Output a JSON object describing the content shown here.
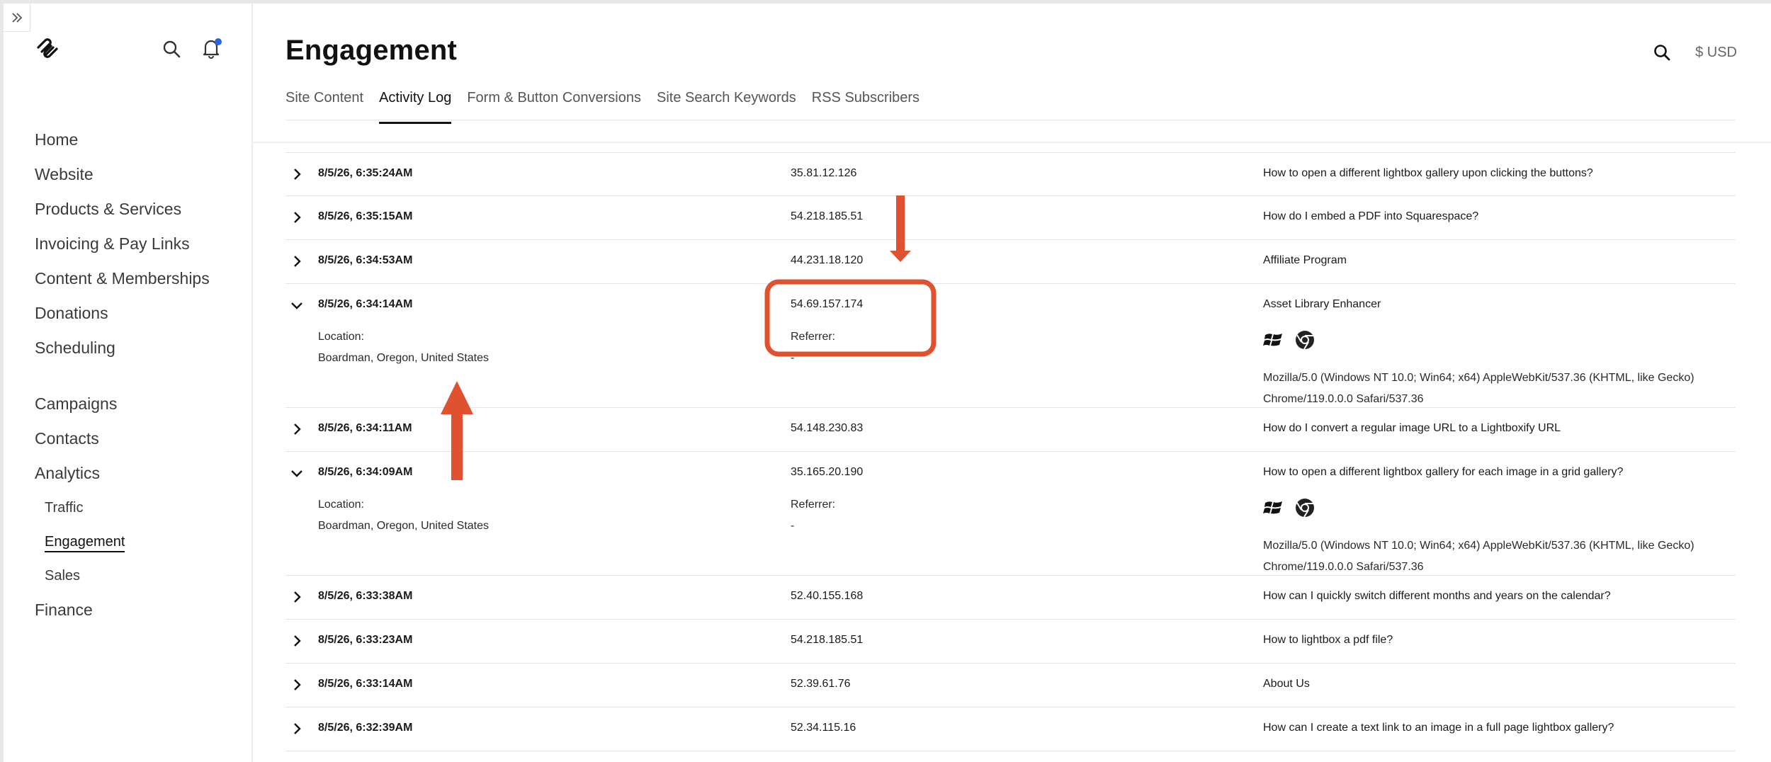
{
  "sidebar": {
    "items": [
      "Home",
      "Website",
      "Products & Services",
      "Invoicing & Pay Links",
      "Content & Memberships",
      "Donations",
      "Scheduling"
    ],
    "items2": [
      "Campaigns",
      "Contacts",
      "Analytics"
    ],
    "analytics_sub": [
      "Traffic",
      "Engagement",
      "Sales"
    ],
    "finance": "Finance"
  },
  "header": {
    "title": "Engagement",
    "currency": "$ USD",
    "tabs": [
      "Site Content",
      "Activity Log",
      "Form & Button Conversions",
      "Site Search Keywords",
      "RSS Subscribers"
    ],
    "active_tab": "Activity Log"
  },
  "log": {
    "location_label": "Location:",
    "referrer_label": "Referrer:",
    "rows": [
      {
        "time": "8/5/26, 6:35:24AM",
        "ip": "35.81.12.126",
        "page": "How to open a different lightbox gallery upon clicking the buttons?",
        "expanded": false
      },
      {
        "time": "8/5/26, 6:35:15AM",
        "ip": "54.218.185.51",
        "page": "How do I embed a PDF into Squarespace?",
        "expanded": false
      },
      {
        "time": "8/5/26, 6:34:53AM",
        "ip": "44.231.18.120",
        "page": "Affiliate Program",
        "expanded": false
      },
      {
        "time": "8/5/26, 6:34:14AM",
        "ip": "54.69.157.174",
        "page": "Asset Library Enhancer",
        "expanded": true,
        "location": "Boardman, Oregon, United States",
        "referrer": "-",
        "user_agent": "Mozilla/5.0 (Windows NT 10.0; Win64; x64) AppleWebKit/537.36 (KHTML, like Gecko) Chrome/119.0.0.0 Safari/537.36"
      },
      {
        "time": "8/5/26, 6:34:11AM",
        "ip": "54.148.230.83",
        "page": "How do I convert a regular image URL to a Lightboxify URL",
        "expanded": false
      },
      {
        "time": "8/5/26, 6:34:09AM",
        "ip": "35.165.20.190",
        "page": "How to open a different lightbox gallery for each image in a grid gallery?",
        "expanded": true,
        "location": "Boardman, Oregon, United States",
        "referrer": "-",
        "user_agent": "Mozilla/5.0 (Windows NT 10.0; Win64; x64) AppleWebKit/537.36 (KHTML, like Gecko) Chrome/119.0.0.0 Safari/537.36"
      },
      {
        "time": "8/5/26, 6:33:38AM",
        "ip": "52.40.155.168",
        "page": "How can I quickly switch different months and years on the calendar?",
        "expanded": false
      },
      {
        "time": "8/5/26, 6:33:23AM",
        "ip": "54.218.185.51",
        "page": "How to lightbox a pdf file?",
        "expanded": false
      },
      {
        "time": "8/5/26, 6:33:14AM",
        "ip": "52.39.61.76",
        "page": "About Us",
        "expanded": false
      },
      {
        "time": "8/5/26, 6:32:39AM",
        "ip": "52.34.115.16",
        "page": "How can I create a text link to an image in a full page lightbox gallery?",
        "expanded": false
      }
    ]
  },
  "colors": {
    "annotation": "#e0522f",
    "notification_dot": "#2a64d6"
  },
  "icons": [
    "sidebar-expand-icon",
    "squarespace-logo-icon",
    "search-icon",
    "bell-icon",
    "chevron-right-icon",
    "chevron-down-icon",
    "windows-icon",
    "chrome-icon"
  ]
}
